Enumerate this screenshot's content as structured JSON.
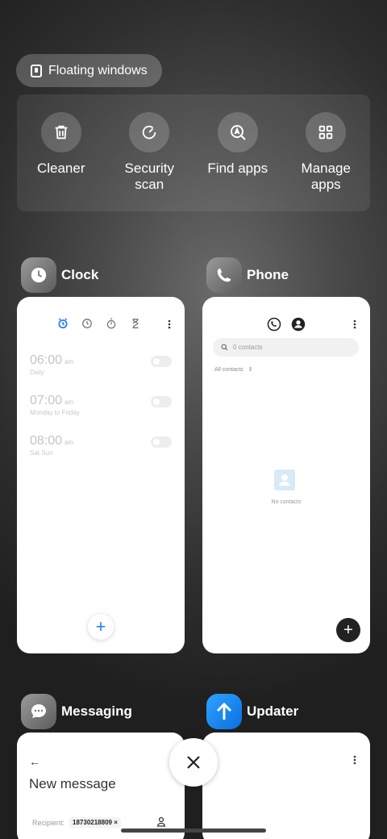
{
  "floating": {
    "label": "Floating windows",
    "icon": "floating-window-icon"
  },
  "tools": [
    {
      "label": "Cleaner",
      "icon": "trash-icon"
    },
    {
      "label": "Security\nscan",
      "icon": "security-scan-icon"
    },
    {
      "label": "Find apps",
      "icon": "find-apps-icon"
    },
    {
      "label": "Manage\napps",
      "icon": "grid-icon"
    }
  ],
  "apps": {
    "clock": {
      "name": "Clock",
      "alarms": [
        {
          "time": "06:00",
          "ampm": "am",
          "repeat": "Daily"
        },
        {
          "time": "07:00",
          "ampm": "am",
          "repeat": "Monday to Friday"
        },
        {
          "time": "08:00",
          "ampm": "am",
          "repeat": "Sat Sun"
        }
      ],
      "add": "+"
    },
    "phone": {
      "name": "Phone",
      "search_placeholder": "0 contacts",
      "filter": "All contacts",
      "empty": "No contacts",
      "add": "+"
    },
    "messaging": {
      "name": "Messaging",
      "back": "←",
      "title": "New message",
      "recipient_label": "Recipient:",
      "recipient_chip": "18730218809 ×"
    },
    "updater": {
      "name": "Updater"
    }
  },
  "colors": {
    "accent": "#2680eb",
    "updater": "#1a8cf5"
  }
}
